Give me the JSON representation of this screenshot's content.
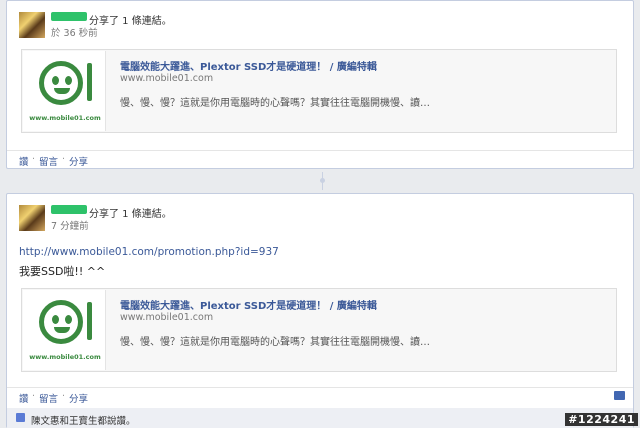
{
  "posts": [
    {
      "share_text": "分享了 1 條連結。",
      "time": "於 36 秒前",
      "link": {
        "title": "電腦效能大躍進、Plextor SSD才是硬道理！ / 廣編特輯",
        "url": "www.mobile01.com",
        "desc": "慢、慢、慢？這就是你用電腦時的心聲嗎？其實往往電腦開機慢、讀…",
        "logo_text": "www.mobile01.com"
      },
      "actions": {
        "like": "讚",
        "comment": "留言",
        "share": "分享",
        "sep": "·"
      }
    },
    {
      "share_text": "分享了 1 條連結。",
      "time": "7 分鐘前",
      "url_text": "http://www.mobile01.com/promotion.php?id=937",
      "message": "我要SSD啦!! ^^",
      "link": {
        "title": "電腦效能大躍進、Plextor SSD才是硬道理！ / 廣編特輯",
        "url": "www.mobile01.com",
        "desc": "慢、慢、慢？這就是你用電腦時的心聲嗎？其實往往電腦開機慢、讀…",
        "logo_text": "www.mobile01.com"
      },
      "actions": {
        "like": "讚",
        "comment": "留言",
        "share": "分享",
        "sep": "·"
      },
      "likes_text": "陳文惠和王寶生都說讚。"
    }
  ],
  "watermark": "#1224241",
  "colors": {
    "link_blue": "#3b5998",
    "logo_green": "#3a8a3f",
    "redaction": "#2ec26a"
  }
}
